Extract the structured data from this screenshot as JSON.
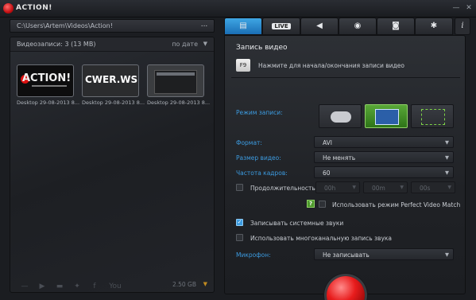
{
  "app": {
    "title": "ACTION!"
  },
  "left": {
    "path": "C:\\Users\\Artem\\Videos\\Action!",
    "path_more": "...",
    "media_count": "Видеозаписи: 3 (13 MB)",
    "sort_label": "по дате",
    "thumbnails": [
      {
        "caption": "Desktop 29-08-2013 8...",
        "logo": "ACTION!"
      },
      {
        "caption": "Desktop 29-08-2013 8...",
        "logo": "CWER.WS"
      },
      {
        "caption": "Desktop 29-08-2013 8...",
        "logo": ""
      }
    ],
    "free_space": "2.50 GB"
  },
  "tabs": {
    "live_label": "LIVE",
    "icons": [
      "video-record-icon",
      "live-stream-icon",
      "audio-icon",
      "benchmark-icon",
      "screenshot-icon",
      "settings-icon"
    ],
    "active_color": "#2a8ad6"
  },
  "video": {
    "section_title": "Запись видео",
    "hotkey": "F9",
    "hotkey_hint": "Нажмите для начала/окончания записи видео",
    "mode_label": "Режим записи:",
    "format_label": "Формат:",
    "format_value": "AVI",
    "size_label": "Размер видео:",
    "size_value": "Не менять",
    "fps_label": "Частота кадров:",
    "fps_value": "60",
    "duration_label": "Продолжительность:",
    "duration_h": "00h",
    "duration_m": "00m",
    "duration_s": "00s",
    "perfect_match_label": "Использовать режим Perfect Video Match",
    "record_system_sounds": "Записывать системные звуки",
    "multichannel_label": "Использовать многоканальную запись звука",
    "mic_label": "Микрофон:",
    "mic_value": "Не записывать"
  },
  "colors": {
    "accent_blue": "#3c9be0",
    "record_red": "#e81c1c",
    "mode_selected": "#4a9a2c"
  }
}
